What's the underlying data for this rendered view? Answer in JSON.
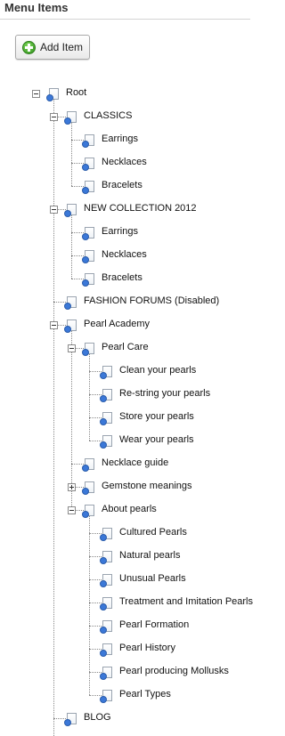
{
  "header": {
    "title": "Menu Items"
  },
  "toolbar": {
    "add_label": "Add Item",
    "add_icon": "plus-circle-icon"
  },
  "tree": [
    {
      "label": "Root",
      "depth": 0,
      "state": "expanded",
      "last": true
    },
    {
      "label": "CLASSICS",
      "depth": 1,
      "state": "expanded",
      "last": false
    },
    {
      "label": "Earrings",
      "depth": 2,
      "state": "leaf",
      "last": false
    },
    {
      "label": "Necklaces",
      "depth": 2,
      "state": "leaf",
      "last": false
    },
    {
      "label": "Bracelets",
      "depth": 2,
      "state": "leaf",
      "last": true
    },
    {
      "label": "NEW COLLECTION 2012",
      "depth": 1,
      "state": "expanded",
      "last": false
    },
    {
      "label": "Earrings",
      "depth": 2,
      "state": "leaf",
      "last": false
    },
    {
      "label": "Necklaces",
      "depth": 2,
      "state": "leaf",
      "last": false
    },
    {
      "label": "Bracelets",
      "depth": 2,
      "state": "leaf",
      "last": true
    },
    {
      "label": "FASHION FORUMS (Disabled)",
      "depth": 1,
      "state": "leaf",
      "last": false
    },
    {
      "label": "Pearl Academy",
      "depth": 1,
      "state": "expanded",
      "last": false
    },
    {
      "label": "Pearl Care",
      "depth": 2,
      "state": "expanded",
      "last": false
    },
    {
      "label": "Clean your pearls",
      "depth": 3,
      "state": "leaf",
      "last": false
    },
    {
      "label": "Re-string your pearls",
      "depth": 3,
      "state": "leaf",
      "last": false
    },
    {
      "label": "Store your pearls",
      "depth": 3,
      "state": "leaf",
      "last": false
    },
    {
      "label": "Wear your pearls",
      "depth": 3,
      "state": "leaf",
      "last": true
    },
    {
      "label": "Necklace guide",
      "depth": 2,
      "state": "leaf",
      "last": false
    },
    {
      "label": "Gemstone meanings",
      "depth": 2,
      "state": "collapsed",
      "last": false
    },
    {
      "label": "About pearls",
      "depth": 2,
      "state": "expanded",
      "last": true
    },
    {
      "label": "Cultured Pearls",
      "depth": 3,
      "state": "leaf",
      "last": false
    },
    {
      "label": "Natural pearls",
      "depth": 3,
      "state": "leaf",
      "last": false
    },
    {
      "label": "Unusual Pearls",
      "depth": 3,
      "state": "leaf",
      "last": false
    },
    {
      "label": "Treatment and Imitation Pearls",
      "depth": 3,
      "state": "leaf",
      "last": false
    },
    {
      "label": "Pearl Formation",
      "depth": 3,
      "state": "leaf",
      "last": false
    },
    {
      "label": "Pearl History",
      "depth": 3,
      "state": "leaf",
      "last": false
    },
    {
      "label": "Pearl producing Mollusks",
      "depth": 3,
      "state": "leaf",
      "last": false
    },
    {
      "label": "Pearl Types",
      "depth": 3,
      "state": "leaf",
      "last": true
    },
    {
      "label": "BLOG",
      "depth": 1,
      "state": "leaf",
      "last": false
    }
  ]
}
